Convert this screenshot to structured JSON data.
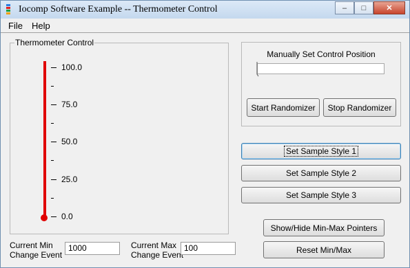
{
  "window": {
    "title": "Iocomp Software Example -- Thermometer Control",
    "controls": {
      "minimize": "–",
      "maximize": "□",
      "close": "✕"
    }
  },
  "menu": {
    "items": [
      "File",
      "Help"
    ]
  },
  "thermometer": {
    "group_label": "Thermometer Control",
    "ticks": [
      "100.0",
      "75.0",
      "50.0",
      "25.0",
      "0.0"
    ],
    "level_fraction": 1.0,
    "color": "#e00000"
  },
  "position": {
    "group_label": "Manually Set Control Position",
    "start_label": "Start Randomizer",
    "stop_label": "Stop Randomizer"
  },
  "styles": {
    "style1": "Set Sample Style 1",
    "style2": "Set Sample Style 2",
    "style3": "Set Sample Style 3"
  },
  "minmax": {
    "show_hide": "Show/Hide Min-Max Pointers",
    "reset": "Reset Min/Max"
  },
  "events": {
    "min_label_line1": "Current Min",
    "min_label_line2": "Change Event",
    "min_value": "1000",
    "max_label_line1": "Current Max",
    "max_label_line2": "Change Event",
    "max_value": "100"
  }
}
